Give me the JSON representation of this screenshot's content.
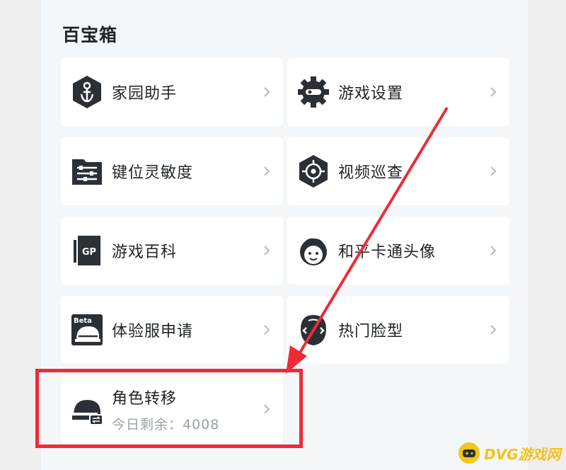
{
  "section": {
    "title": "百宝箱"
  },
  "items": [
    {
      "label": "家园助手",
      "icon": "home-assistant-icon"
    },
    {
      "label": "游戏设置",
      "icon": "gear-icon"
    },
    {
      "label": "键位灵敏度",
      "icon": "sliders-icon"
    },
    {
      "label": "视频巡查",
      "icon": "crosshair-icon"
    },
    {
      "label": "游戏百科",
      "icon": "gp-card-icon"
    },
    {
      "label": "和平卡通头像",
      "icon": "cartoon-avatar-icon"
    },
    {
      "label": "体验服申请",
      "icon": "beta-helmet-icon"
    },
    {
      "label": "热门脸型",
      "icon": "face-shape-icon"
    }
  ],
  "transfer": {
    "label": "角色转移",
    "subtitle": "今日剩余：4008",
    "icon": "helmet-transfer-icon"
  },
  "annotation": {
    "color": "#ee2b37"
  },
  "watermark": {
    "text": "DVG游戏网",
    "color": "#f4c21a"
  }
}
